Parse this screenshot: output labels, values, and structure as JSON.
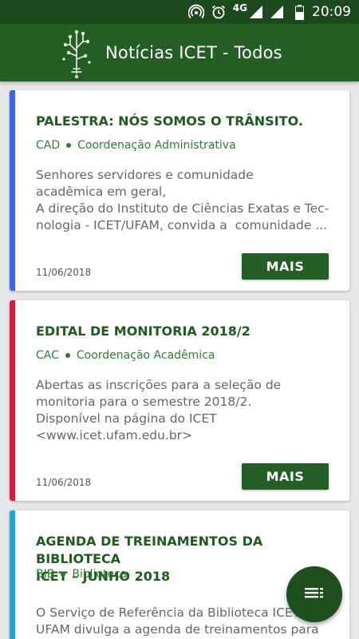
{
  "status_bar": {
    "network": "4G",
    "time": "20:09",
    "icons": [
      "hotspot-icon",
      "alarm-icon",
      "signal-icon",
      "wifi-signal-icon",
      "battery-icon"
    ]
  },
  "app_bar": {
    "logo": "icet-circuit-tree-logo",
    "title": "Notícias ICET - Todos"
  },
  "news": [
    {
      "title": "PALESTRA: NÓS SOMOS O TRÂNSITO.",
      "dept_code": "CAD",
      "dept_name": "Coordenação Administrativa",
      "excerpt": "Senhores servidores e comunidade acadêmica em geral,\nA direção do Instituto de Ciências Exatas e Tecnologia - ICET/UFAM, convida a  comunidade ...",
      "date": "11/06/2018",
      "action": "MAIS",
      "stripe_color": "#3d64f0"
    },
    {
      "title": "EDITAL DE MONITORIA 2018/2",
      "dept_code": "CAC",
      "dept_name": "Coordenação Acadêmica",
      "excerpt": "Abertas as inscrições para a seleção de monitoria para o semestre 2018/2.\nDisponível na página do ICET <www.icet.ufam.edu.br>",
      "date": "11/06/2018",
      "action": "MAIS",
      "stripe_color": "#d81b40"
    },
    {
      "title": "AGENDA DE TREINAMENTOS DA BIBLIOTECA ICET – JUNHO 2018",
      "dept_code": "BIB",
      "dept_name": "Biblioteca",
      "excerpt": "O Serviço de Referência da Biblioteca ICET UFAM divulga a agenda de treinamentos para",
      "stripe_color": "#1ea7d8"
    }
  ],
  "fab": {
    "icon": "filter-list-icon"
  },
  "colors": {
    "status_bar": "#1c4a1c",
    "app_bar": "#255e25",
    "title_text": "#1f5a1f",
    "meta_text": "#2e7d32",
    "background": "#e6e7e8"
  }
}
